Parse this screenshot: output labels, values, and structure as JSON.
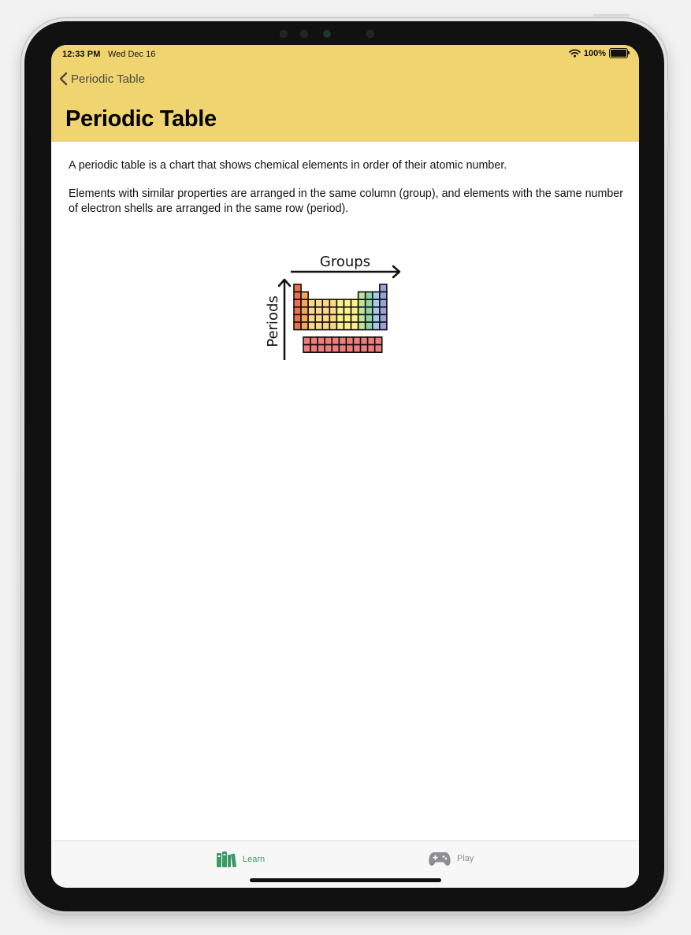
{
  "status_bar": {
    "time": "12:33 PM",
    "date": "Wed Dec 16",
    "battery": "100%"
  },
  "nav": {
    "back_label": "Periodic Table",
    "title": "Periodic Table"
  },
  "content": {
    "paragraphs": [
      "A periodic table is a chart that shows chemical elements in order of their atomic number.",
      "Elements with similar properties are arranged in the same column (group), and elements with the same number of electron shells are arranged in the same row (period)."
    ],
    "illustration": {
      "groups_label": "Groups",
      "periods_label": "Periods"
    }
  },
  "tabbar": {
    "tabs": [
      {
        "label": "Learn",
        "icon": "books-icon",
        "selected": true
      },
      {
        "label": "Play",
        "icon": "gamepad-icon",
        "selected": false
      }
    ]
  },
  "colors": {
    "header": "#f0d470",
    "tab_selected": "#3c9a66",
    "tab_unselected": "#8e8e93"
  }
}
